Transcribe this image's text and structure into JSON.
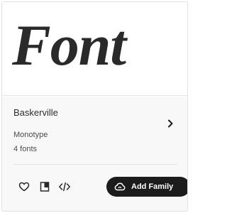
{
  "preview": {
    "sample_text": "Font"
  },
  "family": {
    "name": "Baskerville",
    "foundry": "Monotype",
    "count": "4 fonts"
  },
  "actions": {
    "add_label": "Add Family"
  },
  "icons": {
    "favorite": "heart-icon",
    "specimen": "specimen-book-icon",
    "embed": "code-icon",
    "navigate": "chevron-right-icon",
    "creative_cloud": "creative-cloud-icon"
  },
  "colors": {
    "button_bg": "#1c1c1c",
    "info_bg": "#f8f8f8",
    "text": "#2c2c2c"
  }
}
